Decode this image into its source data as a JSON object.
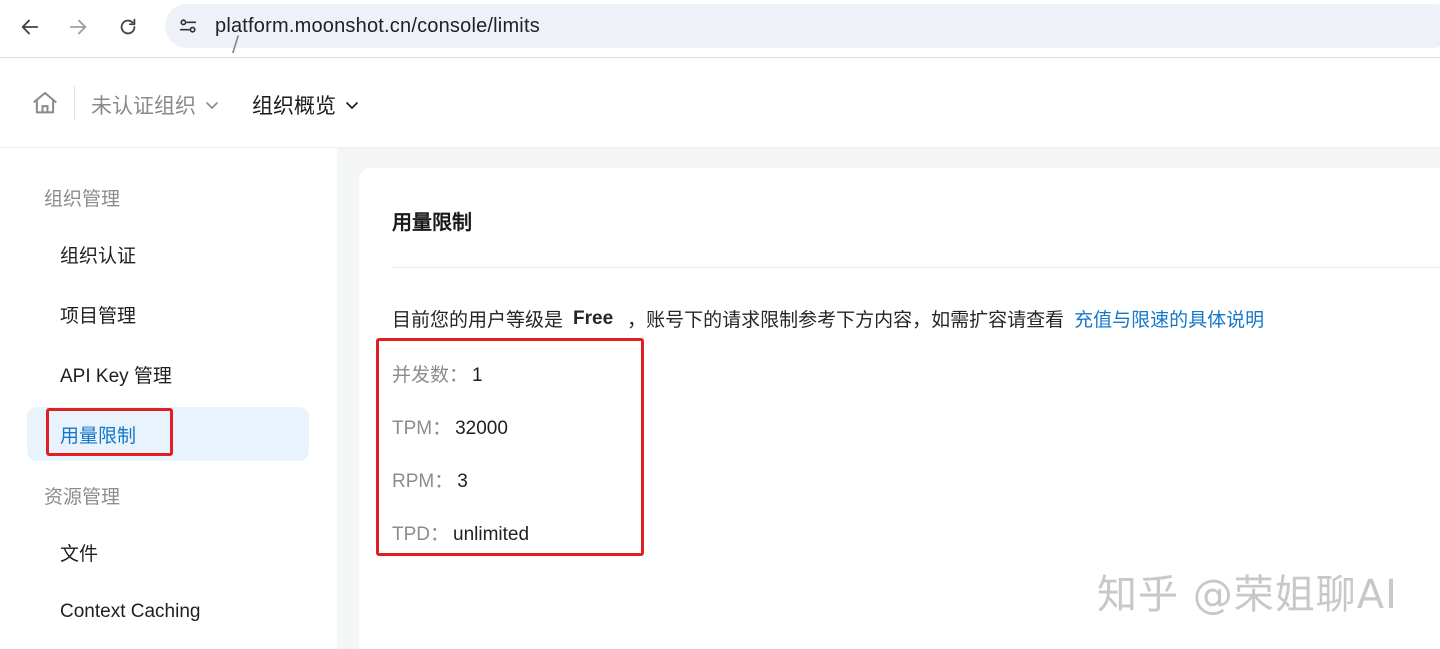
{
  "browser": {
    "url": "platform.moonshot.cn/console/limits"
  },
  "header": {
    "org_name": "未认证组织",
    "separator": "/",
    "page_name": "组织概览"
  },
  "sidebar": {
    "group_org": "组织管理",
    "items_org": [
      {
        "label": "组织认证",
        "active": false
      },
      {
        "label": "项目管理",
        "active": false
      },
      {
        "label": "API Key 管理",
        "active": false
      },
      {
        "label": "用量限制",
        "active": true
      }
    ],
    "group_resource": "资源管理",
    "items_resource": [
      {
        "label": "文件",
        "active": false
      },
      {
        "label": "Context Caching",
        "active": false
      }
    ]
  },
  "main": {
    "title": "用量限制",
    "intro_prefix": "目前您的用户等级是",
    "user_level": "Free",
    "intro_suffix": "，账号下的请求限制参考下方内容，如需扩容请查看",
    "link_text": "充值与限速的具体说明",
    "limits": [
      {
        "key": "并发数：",
        "value": "1"
      },
      {
        "key": "TPM：",
        "value": "32000"
      },
      {
        "key": "RPM：",
        "value": "3"
      },
      {
        "key": "TPD：",
        "value": "unlimited"
      }
    ]
  },
  "watermark": "知乎 @荣姐聊AI",
  "colors": {
    "accent": "#1677c9",
    "active_bg": "#e8f3fd",
    "highlight_box": "#e02020"
  }
}
